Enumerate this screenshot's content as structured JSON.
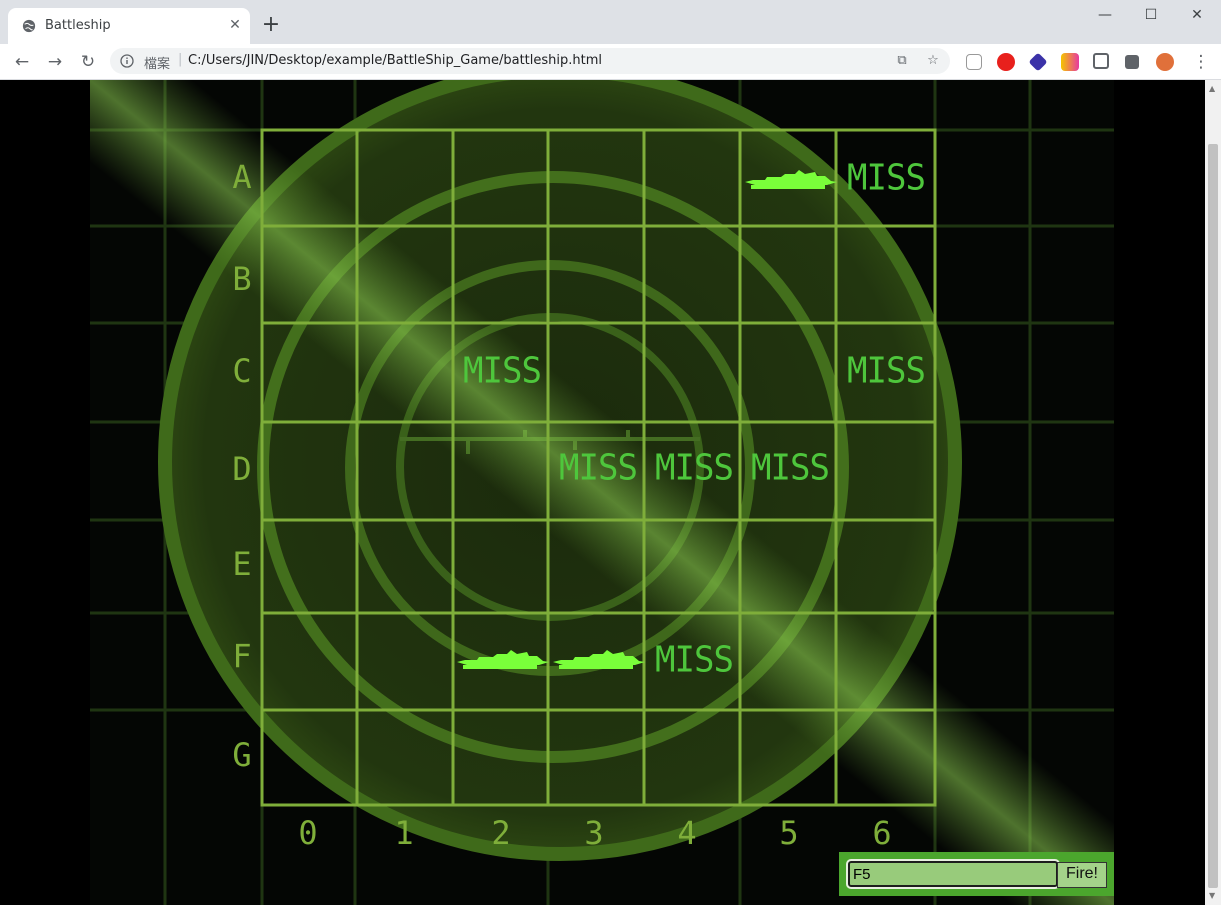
{
  "browser": {
    "tab_title": "Battleship",
    "url_prefix": "檔案",
    "url": "C:/Users/JIN/Desktop/example/BattleShip_Game/battleship.html"
  },
  "board": {
    "row_labels": [
      "A",
      "B",
      "C",
      "D",
      "E",
      "F",
      "G"
    ],
    "col_labels": [
      "0",
      "1",
      "2",
      "3",
      "4",
      "5",
      "6"
    ],
    "miss_text": "MISS",
    "misses": [
      "A6",
      "C2",
      "C6",
      "D3",
      "D4",
      "D5",
      "F4"
    ],
    "hits": [
      "A5",
      "F2",
      "F3"
    ]
  },
  "form": {
    "guess_value": "F5",
    "fire_label": "Fire!"
  },
  "colors": {
    "radar_green": "#5a8c2a",
    "grid_line": "#7fae3a",
    "miss_text": "#4ec63c",
    "ship": "#7aff3a",
    "form_bg": "#4ba62d"
  }
}
